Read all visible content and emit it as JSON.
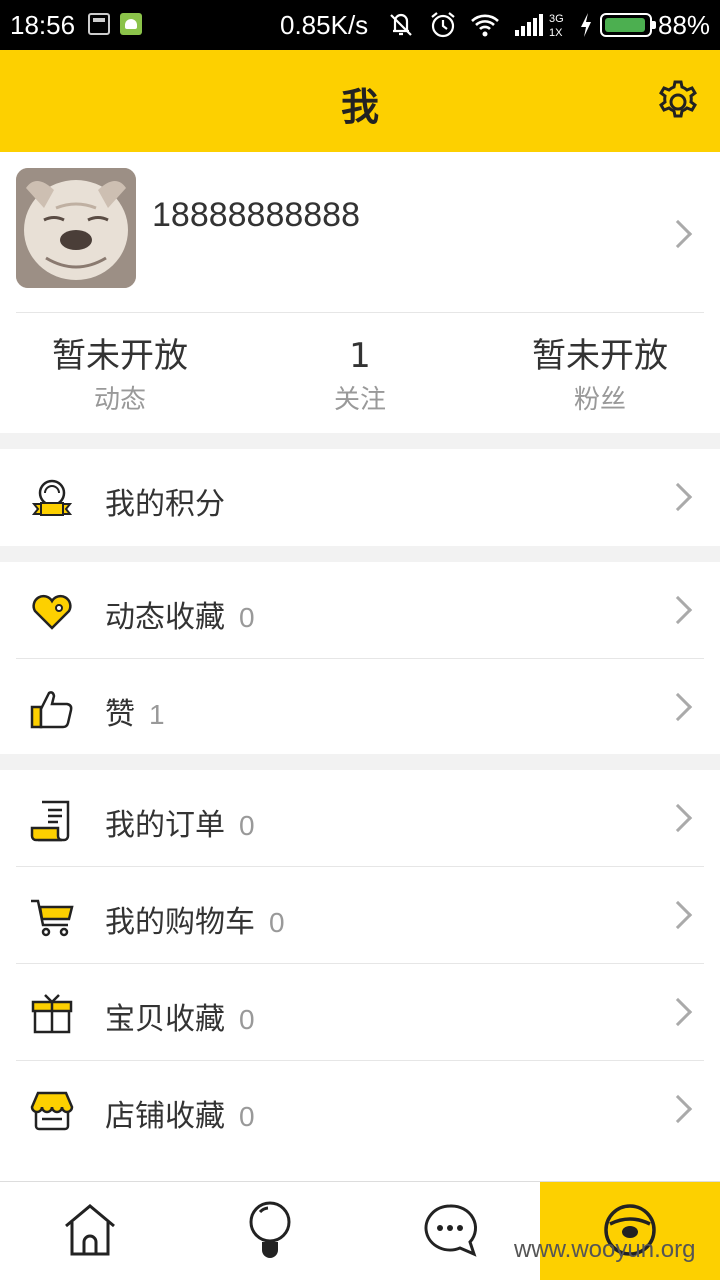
{
  "status_bar": {
    "time": "18:56",
    "network_speed": "0.85K/s",
    "network_type": "3G 1X",
    "battery_percent": "88%",
    "battery_level": 0.88
  },
  "header": {
    "title": "我",
    "settings_icon": "gear-icon"
  },
  "profile": {
    "username": "18888888888",
    "stats": [
      {
        "value": "暂未开放",
        "label": "动态"
      },
      {
        "value": "1",
        "label": "关注"
      },
      {
        "value": "暂未开放",
        "label": "粉丝"
      }
    ]
  },
  "menu": {
    "points": {
      "label": "我的积分",
      "icon": "medal-icon"
    },
    "dynamic_fav": {
      "label": "动态收藏",
      "count": "0",
      "icon": "heart-icon"
    },
    "likes": {
      "label": "赞",
      "count": "1",
      "icon": "thumbs-up-icon"
    },
    "orders": {
      "label": "我的订单",
      "count": "0",
      "icon": "receipt-icon"
    },
    "cart": {
      "label": "我的购物车",
      "count": "0",
      "icon": "cart-icon"
    },
    "item_fav": {
      "label": "宝贝收藏",
      "count": "0",
      "icon": "gift-icon"
    },
    "shop_fav": {
      "label": "店铺收藏",
      "count": "0",
      "icon": "shop-icon"
    }
  },
  "bottom_nav": [
    {
      "name": "home",
      "icon": "home-icon"
    },
    {
      "name": "discover",
      "icon": "bulb-icon"
    },
    {
      "name": "messages",
      "icon": "chat-icon"
    },
    {
      "name": "me",
      "icon": "face-icon",
      "active": true
    }
  ],
  "watermark": "www.wooyun.org",
  "colors": {
    "accent": "#fdd000",
    "text": "#333333",
    "muted": "#999999"
  }
}
